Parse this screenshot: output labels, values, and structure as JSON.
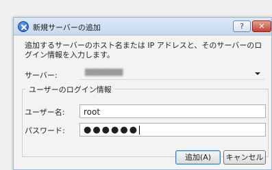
{
  "dialog": {
    "title": "新規サーバーの追加",
    "help_label": "?",
    "close_label": "✕",
    "description": "追加するサーバーのホスト名または IP アドレスと、そのサーバーのログイン情報を入力します。",
    "server_label": "サーバー:",
    "server_value": "████████",
    "group_title": "ユーザーのログイン情報",
    "username_label": "ユーザー名:",
    "username_value": "root",
    "password_label": "パスワード:",
    "password_value": "●●●●●●",
    "add_button": "追加(A)",
    "cancel_button": "キャンセル"
  },
  "icons": {
    "app": "server-add-icon",
    "dropdown": "chevron-down-icon"
  },
  "colors": {
    "titlebar": "#c7d9ee",
    "close": "#c6422e",
    "accent": "#3c7fb1"
  }
}
